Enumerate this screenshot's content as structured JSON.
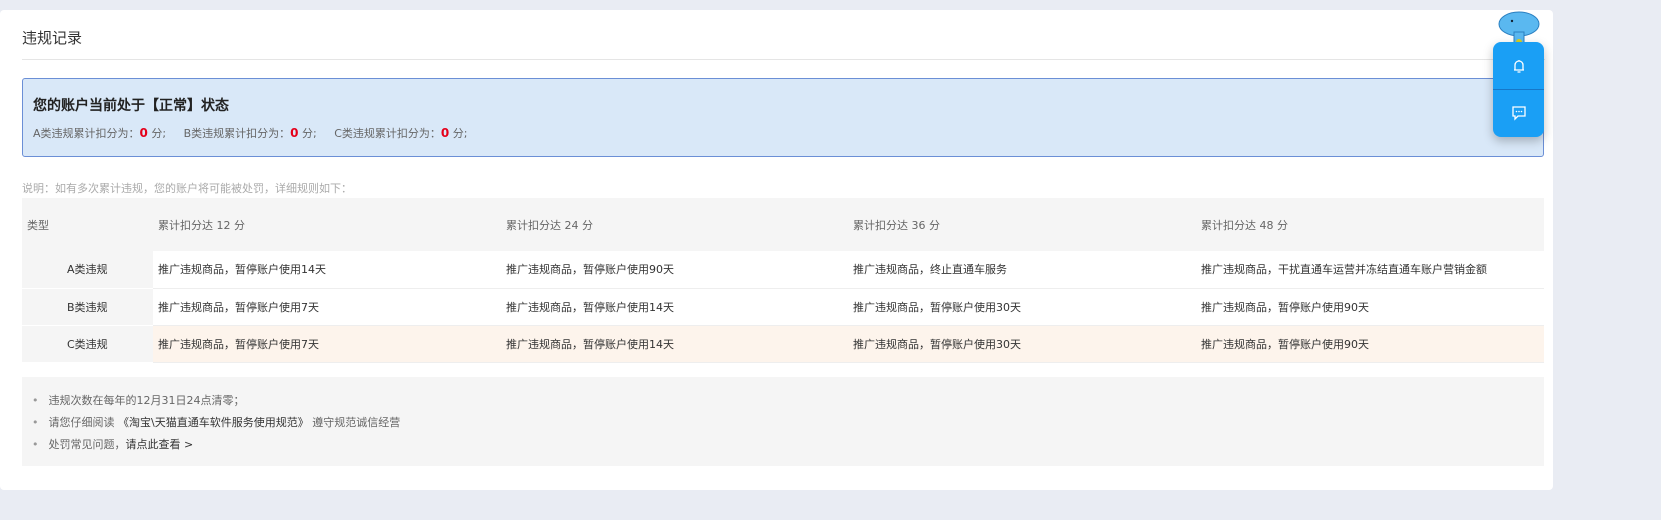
{
  "title": "违规记录",
  "status": {
    "heading": "您的账户当前处于【正常】状态",
    "scores": [
      {
        "label": "A类违规累计扣分为：",
        "value": "0",
        "unit": "分;"
      },
      {
        "label": "B类违规累计扣分为：",
        "value": "0",
        "unit": "分;"
      },
      {
        "label": "C类违规累计扣分为：",
        "value": "0",
        "unit": "分;"
      }
    ]
  },
  "note": "说明：如有多次累计违规，您的账户将可能被处罚，详细规则如下：",
  "table": {
    "headers": [
      "类型",
      "累计扣分达 12 分",
      "累计扣分达 24 分",
      "累计扣分达 36 分",
      "累计扣分达 48 分"
    ],
    "rows": [
      [
        "A类违规",
        "推广违规商品，暂停账户使用14天",
        "推广违规商品，暂停账户使用90天",
        "推广违规商品，终止直通车服务",
        "推广违规商品，干扰直通车运营并冻结直通车账户营销金额"
      ],
      [
        "B类违规",
        "推广违规商品，暂停账户使用7天",
        "推广违规商品，暂停账户使用14天",
        "推广违规商品，暂停账户使用30天",
        "推广违规商品，暂停账户使用90天"
      ],
      [
        "C类违规",
        "推广违规商品，暂停账户使用7天",
        "推广违规商品，暂停账户使用14天",
        "推广违规商品，暂停账户使用30天",
        "推广违规商品，暂停账户使用90天"
      ]
    ]
  },
  "footer": {
    "item1": "违规次数在每年的12月31日24点清零；",
    "item2_pre": "请您仔细阅读 ",
    "item2_link": "《淘宝\\天猫直通车软件服务使用规范》",
    "item2_post": " 遵守规范诚信经营",
    "item3_pre": "处罚常见问题，",
    "item3_link": "请点此查看 >"
  },
  "colors": {
    "accent": "#1a9ff5",
    "red": "#e5001a"
  }
}
